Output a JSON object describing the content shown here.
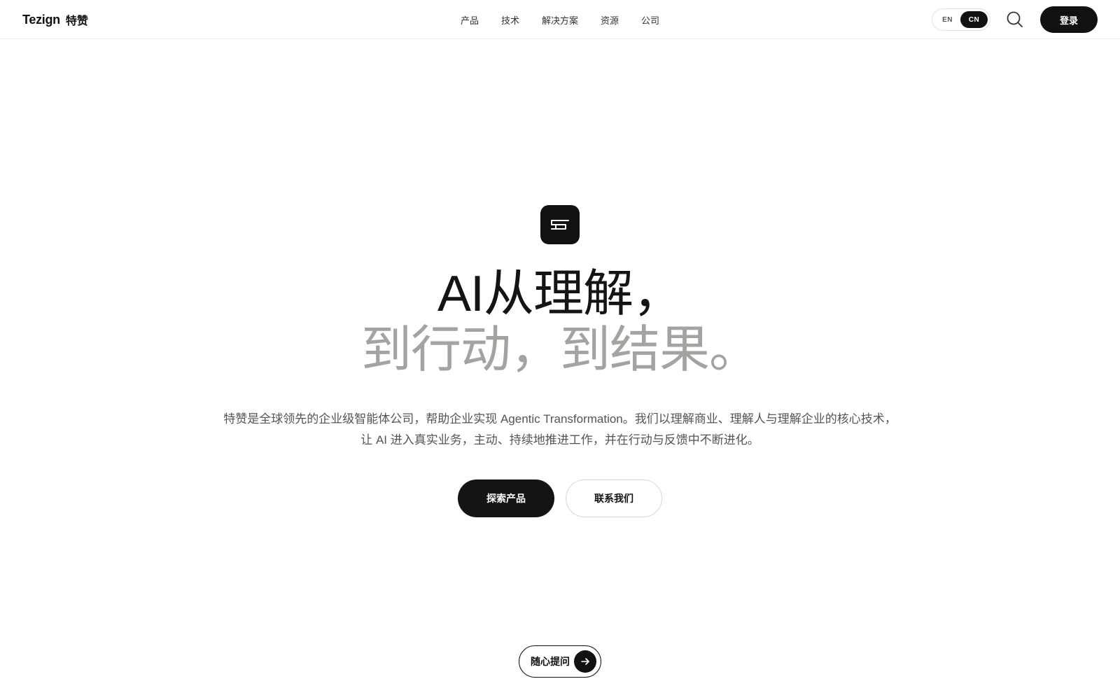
{
  "header": {
    "brand_en": "Tezign",
    "brand_cn": "特赞",
    "nav": [
      "产品",
      "技术",
      "解决方案",
      "资源",
      "公司"
    ],
    "lang_options": [
      "EN",
      "CN"
    ],
    "lang_selected": "CN",
    "search_icon": "search-icon",
    "login_label": "登录"
  },
  "hero": {
    "logo_icon": "tezign-logo-icon",
    "headline_line1": "AI从理解，",
    "headline_line2": "到行动，到结果。",
    "description_line1": "特赞是全球领先的企业级智能体公司，帮助企业实现 Agentic Transformation。我们以理解商业、理解人与理解企业的核心技术，",
    "description_line2": "让 AI 进入真实业务，主动、持续地推进工作，并在行动与反馈中不断进化。",
    "primary_cta": "探索产品",
    "secondary_cta": "联系我们"
  },
  "ask": {
    "label": "随心提问",
    "icon": "arrow-right-icon"
  },
  "colors": {
    "primary": "#111111",
    "headline_muted": "#a3a3a0",
    "body_text": "#555555"
  }
}
